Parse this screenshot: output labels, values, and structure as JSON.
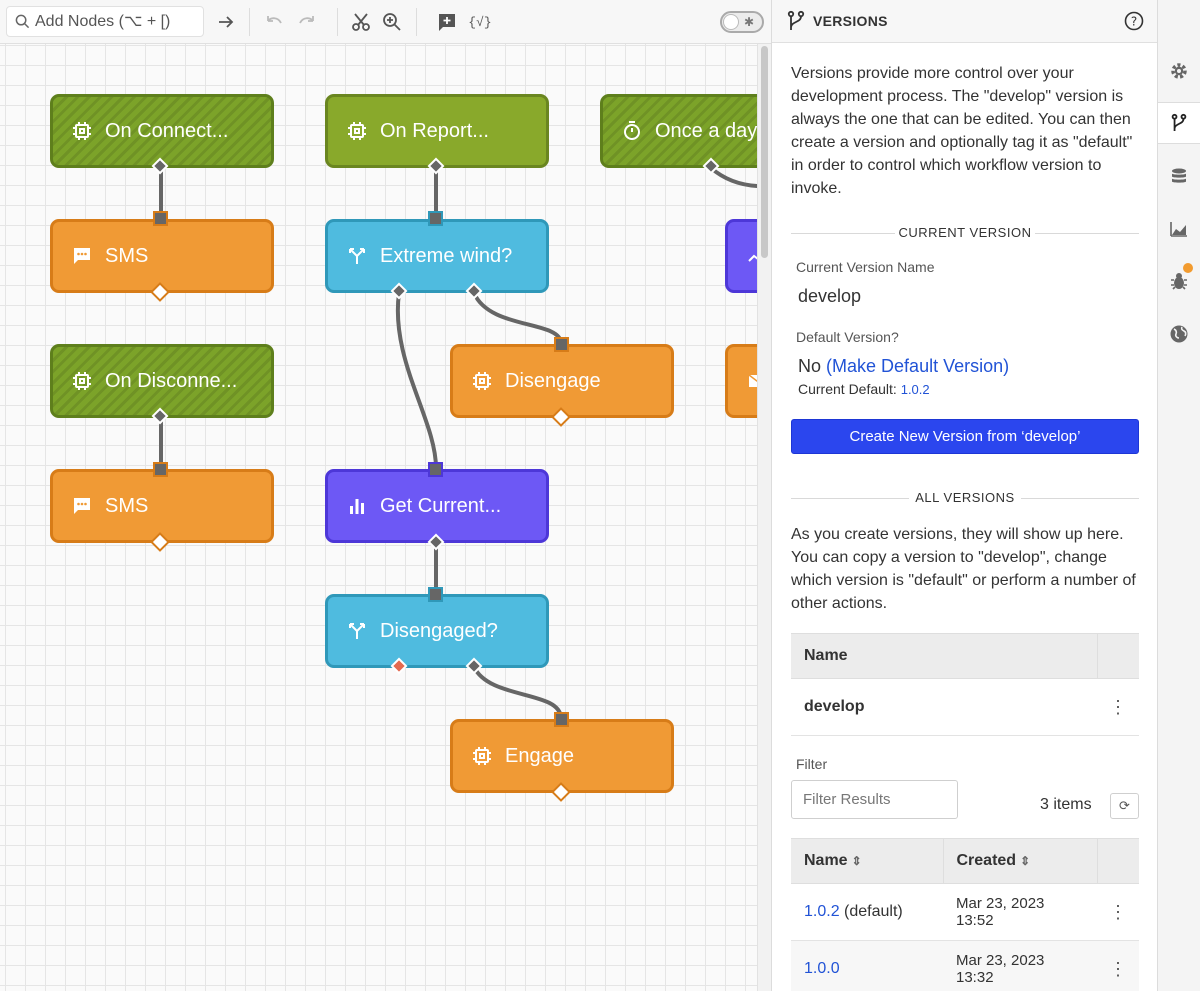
{
  "toolbar": {
    "search_placeholder": "Add Nodes (⌥ + [)",
    "expression_label": "{√}"
  },
  "nodes": [
    {
      "id": "n1",
      "label": "On Connect...",
      "kind": "trigger",
      "icon": "chip-icon"
    },
    {
      "id": "n2",
      "label": "On Report...",
      "kind": "report",
      "icon": "chip-icon"
    },
    {
      "id": "n3",
      "label": "Once a day...",
      "kind": "trigger",
      "icon": "timer-icon"
    },
    {
      "id": "n4",
      "label": "SMS",
      "kind": "orange",
      "icon": "message-icon"
    },
    {
      "id": "n5",
      "label": "Extreme wind?",
      "kind": "blue",
      "icon": "branch-icon"
    },
    {
      "id": "n6",
      "label": "On Disconne...",
      "kind": "trigger",
      "icon": "chip-icon"
    },
    {
      "id": "n7",
      "label": "Disengage",
      "kind": "orange",
      "icon": "chip-icon"
    },
    {
      "id": "n8",
      "label": "SMS",
      "kind": "orange",
      "icon": "message-icon"
    },
    {
      "id": "n9",
      "label": "Get Current...",
      "kind": "purple",
      "icon": "bar-chart-icon"
    },
    {
      "id": "n10",
      "label": "Disengaged?",
      "kind": "blue",
      "icon": "branch-icon"
    },
    {
      "id": "n11",
      "label": "Engage",
      "kind": "orange",
      "icon": "chip-icon"
    }
  ],
  "panel": {
    "title": "VERSIONS",
    "intro": "Versions provide more control over your development process. The \"develop\" version is always the one that can be edited. You can then create a version and optionally tag it as \"default\" in order to control which workflow version to invoke.",
    "current_section": "CURRENT VERSION",
    "current_name_label": "Current Version Name",
    "current_name": "develop",
    "default_label": "Default Version?",
    "default_value": "No",
    "make_default_link": "(Make Default Version)",
    "current_default_label": "Current Default:",
    "current_default_value": "1.0.2",
    "create_button": "Create New Version from ‘develop’",
    "all_section": "ALL VERSIONS",
    "all_intro": "As you create versions, they will show up here. You can copy a version to \"develop\", change which version is \"default\" or perform a number of other actions.",
    "develop_table": {
      "header": "Name",
      "row": "develop"
    },
    "filter_label": "Filter",
    "filter_placeholder": "Filter Results",
    "count": "3 items",
    "versions_table": {
      "headers": [
        "Name",
        "Created"
      ],
      "rows": [
        {
          "name": "1.0.2",
          "tag": "(default)",
          "created": "Mar 23, 2023 13:52"
        },
        {
          "name": "1.0.0",
          "tag": "",
          "created": "Mar 23, 2023 13:32"
        }
      ]
    }
  },
  "colors": {
    "trigger": "#7ca329",
    "action": "#f09a35",
    "conditional": "#4fbbdf",
    "data": "#6d58f5",
    "primary_button": "#2b46ee",
    "link": "#2153d6"
  }
}
